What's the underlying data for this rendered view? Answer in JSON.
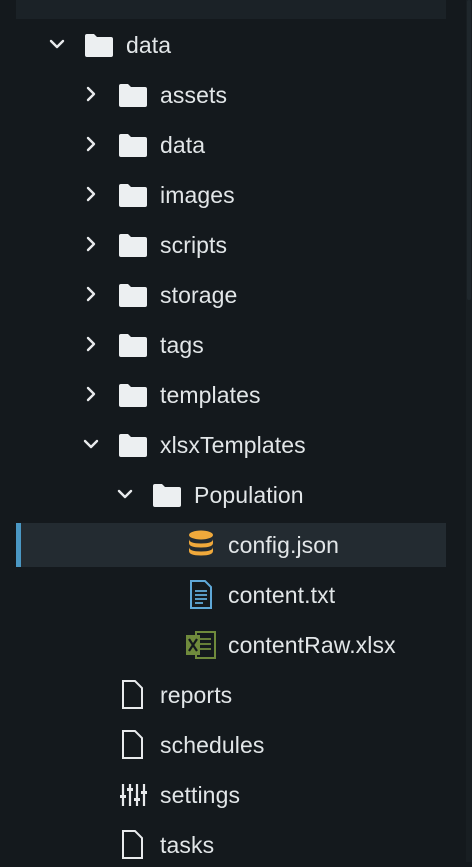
{
  "tree": {
    "root": {
      "label": "data",
      "expanded": true
    },
    "children": [
      {
        "label": "assets",
        "type": "folder",
        "expanded": false
      },
      {
        "label": "data",
        "type": "folder",
        "expanded": false
      },
      {
        "label": "images",
        "type": "folder",
        "expanded": false
      },
      {
        "label": "scripts",
        "type": "folder",
        "expanded": false
      },
      {
        "label": "storage",
        "type": "folder",
        "expanded": false
      },
      {
        "label": "tags",
        "type": "folder",
        "expanded": false
      },
      {
        "label": "templates",
        "type": "folder",
        "expanded": false
      },
      {
        "label": "xlsxTemplates",
        "type": "folder",
        "expanded": true
      },
      {
        "label": "Population",
        "type": "folder",
        "expanded": true
      },
      {
        "label": "config.json",
        "type": "file",
        "icon": "database-icon",
        "selected": true
      },
      {
        "label": "content.txt",
        "type": "file",
        "icon": "text-file-icon"
      },
      {
        "label": "contentRaw.xlsx",
        "type": "file",
        "icon": "excel-icon"
      },
      {
        "label": "reports",
        "type": "file",
        "icon": "file-icon"
      },
      {
        "label": "schedules",
        "type": "file",
        "icon": "file-icon"
      },
      {
        "label": "settings",
        "type": "file",
        "icon": "sliders-icon"
      },
      {
        "label": "tasks",
        "type": "file",
        "icon": "file-icon"
      }
    ]
  },
  "colors": {
    "background": "#14191d",
    "selected_row": "#232b31",
    "selection_accent": "#4a97c3",
    "text": "#e2e6e8",
    "folder": "#eceff1",
    "database_icon": "#f0a93b",
    "text_file_icon": "#5fa8d8",
    "excel_icon": "#6f8a3c"
  }
}
